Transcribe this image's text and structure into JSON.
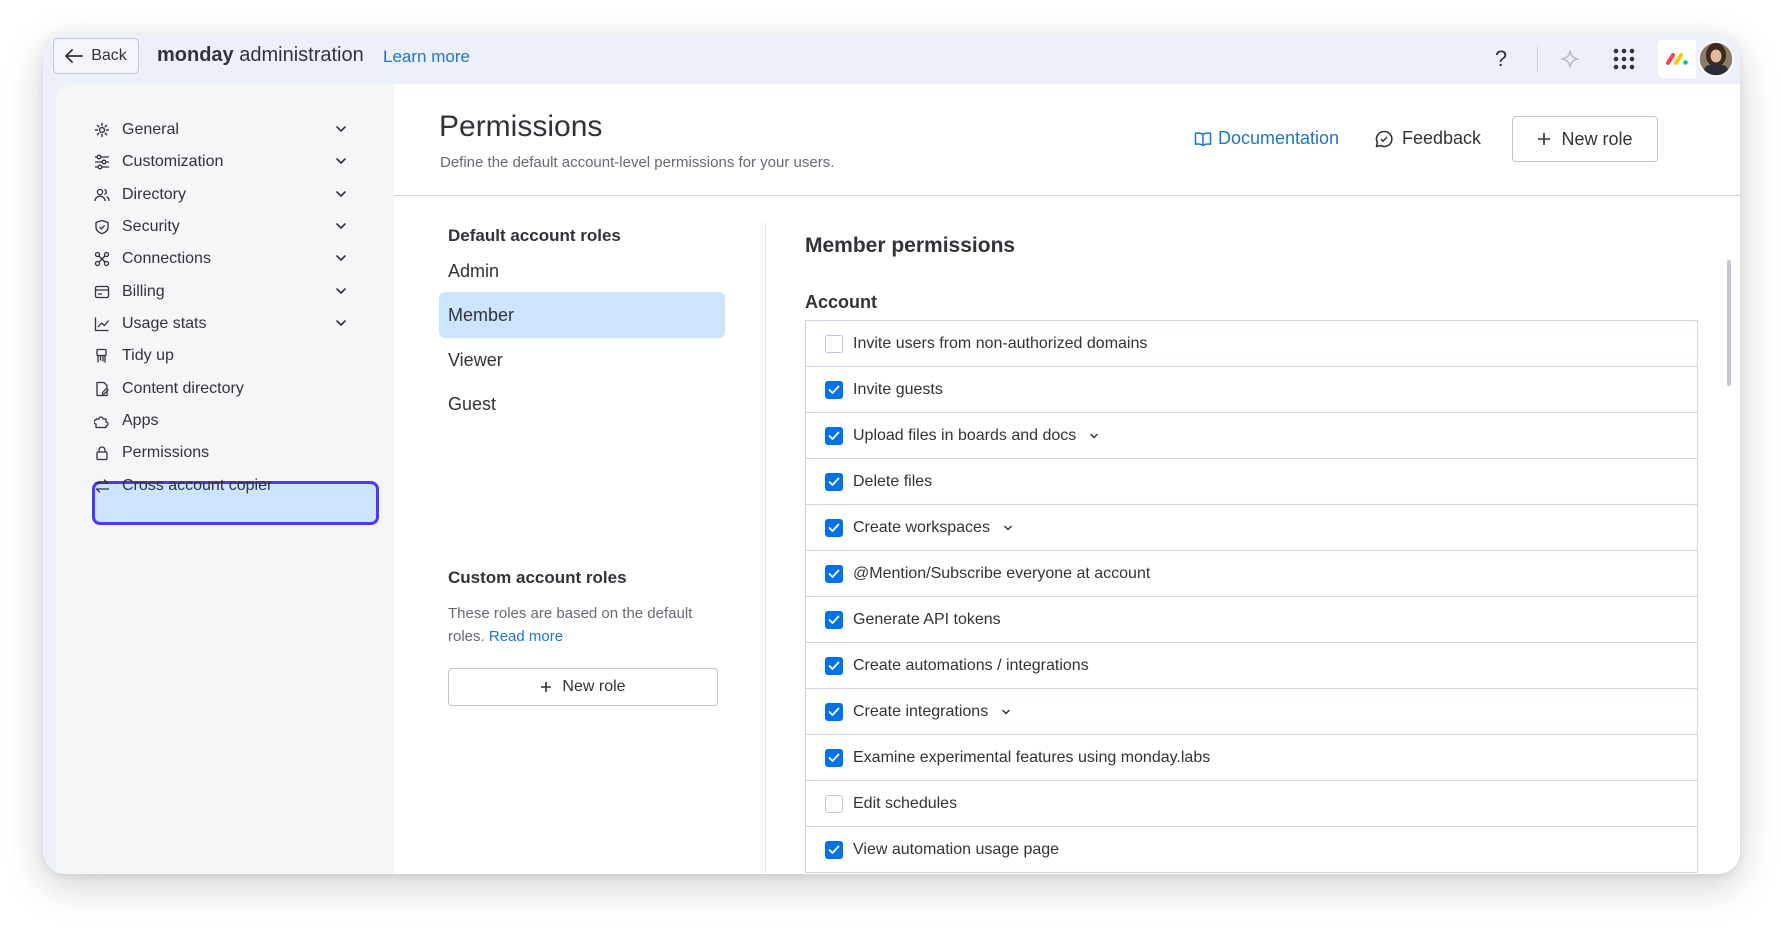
{
  "topbar": {
    "back_label": "Back",
    "brand_bold": "monday",
    "brand_rest": " administration",
    "learn_more": "Learn more",
    "help_glyph": "?"
  },
  "sidebar": {
    "items": [
      {
        "label": "General",
        "icon": "gear-icon",
        "expandable": true
      },
      {
        "label": "Customization",
        "icon": "sliders-icon",
        "expandable": true
      },
      {
        "label": "Directory",
        "icon": "users-icon",
        "expandable": true
      },
      {
        "label": "Security",
        "icon": "shield-icon",
        "expandable": true
      },
      {
        "label": "Connections",
        "icon": "connections-icon",
        "expandable": true
      },
      {
        "label": "Billing",
        "icon": "billing-icon",
        "expandable": true
      },
      {
        "label": "Usage stats",
        "icon": "chart-icon",
        "expandable": true
      },
      {
        "label": "Tidy up",
        "icon": "broom-icon",
        "expandable": false
      },
      {
        "label": "Content directory",
        "icon": "document-icon",
        "expandable": false
      },
      {
        "label": "Apps",
        "icon": "puzzle-icon",
        "expandable": false
      },
      {
        "label": "Permissions",
        "icon": "lock-icon",
        "expandable": false,
        "active": true
      },
      {
        "label": "Cross account copier",
        "icon": "swap-icon",
        "expandable": false
      }
    ]
  },
  "header": {
    "title": "Permissions",
    "subtitle": "Define the default account-level permissions for your users.",
    "documentation": "Documentation",
    "feedback": "Feedback",
    "new_role": "New role"
  },
  "roles": {
    "default_title": "Default account roles",
    "default_roles": [
      "Admin",
      "Member",
      "Viewer",
      "Guest"
    ],
    "selected": "Member",
    "custom_title": "Custom account roles",
    "custom_desc": "These roles are based on the default roles.",
    "read_more": "Read more",
    "new_role": "New role"
  },
  "permissions": {
    "title": "Member permissions",
    "section": "Account",
    "items": [
      {
        "label": "Invite users from non-authorized domains",
        "checked": false,
        "expandable": false
      },
      {
        "label": "Invite guests",
        "checked": true,
        "expandable": false
      },
      {
        "label": "Upload files in boards and docs",
        "checked": true,
        "expandable": true
      },
      {
        "label": "Delete files",
        "checked": true,
        "expandable": false
      },
      {
        "label": "Create workspaces",
        "checked": true,
        "expandable": true
      },
      {
        "label": "@Mention/Subscribe everyone at account",
        "checked": true,
        "expandable": false
      },
      {
        "label": "Generate API tokens",
        "checked": true,
        "expandable": false
      },
      {
        "label": "Create automations / integrations",
        "checked": true,
        "expandable": false
      },
      {
        "label": "Create integrations",
        "checked": true,
        "expandable": true
      },
      {
        "label": "Examine experimental features using monday.labs",
        "checked": true,
        "expandable": false
      },
      {
        "label": "Edit schedules",
        "checked": false,
        "expandable": false
      },
      {
        "label": "View automation usage page",
        "checked": true,
        "expandable": false
      }
    ]
  },
  "colors": {
    "accent": "#0073ea",
    "link": "#1f76c2",
    "active_outline": "#5034ff",
    "selected_bg": "#cce5ff"
  }
}
